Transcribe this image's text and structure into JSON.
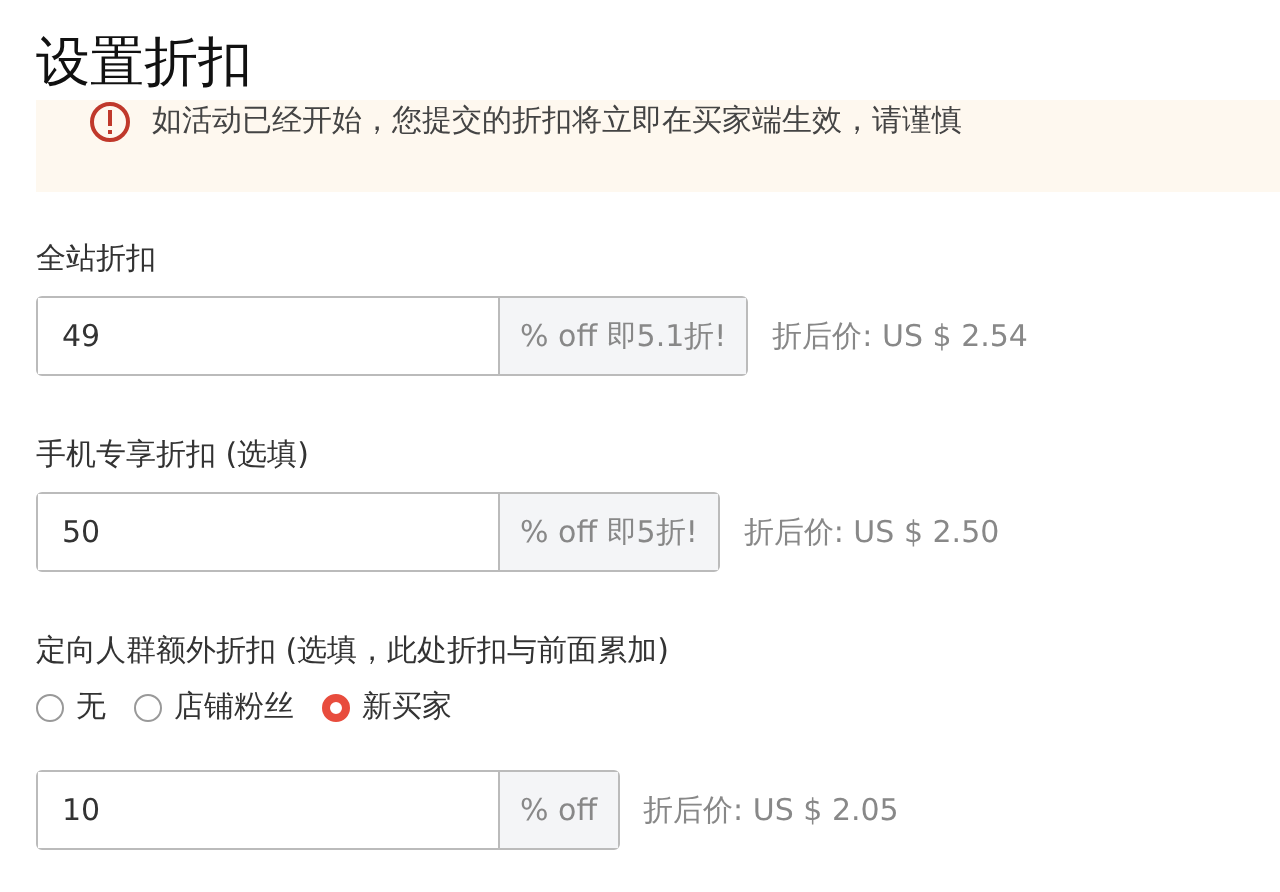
{
  "title": "设置折扣",
  "notice": {
    "text": "如活动已经开始，您提交的折扣将立即在买家端生效，请谨慎"
  },
  "fields": [
    {
      "label": "全站折扣",
      "value": "49",
      "suffix": "% off 即5.1折!",
      "price": "折后价: US $ 2.54"
    },
    {
      "label": "手机专享折扣 (选填)",
      "value": "50",
      "suffix": "% off 即5折!",
      "price": "折后价: US $ 2.50"
    },
    {
      "label": "定向人群额外折扣 (选填，此处折扣与前面累加)",
      "options": [
        {
          "label": "无",
          "selected": false
        },
        {
          "label": "店铺粉丝",
          "selected": false
        },
        {
          "label": "新买家",
          "selected": true
        }
      ],
      "value": "10",
      "suffix": "% off",
      "price": "折后价: US $ 2.05"
    }
  ]
}
